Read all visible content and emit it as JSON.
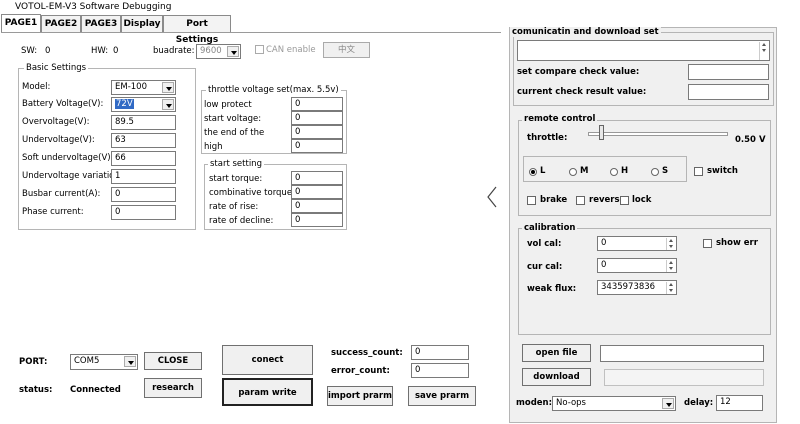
{
  "window": {
    "title": "VOTOL-EM-V3 Software Debugging"
  },
  "tabs": [
    {
      "label": "PAGE1"
    },
    {
      "label": "PAGE2"
    },
    {
      "label": "PAGE3"
    },
    {
      "label": "Display"
    },
    {
      "label": "Port Settings"
    }
  ],
  "top": {
    "sw_label": "SW:",
    "sw_value": "0",
    "hw_label": "HW:",
    "hw_value": "0",
    "baud_label": "buadrate:",
    "baud_value": "9600",
    "can_label": "CAN enable",
    "lang_button": "中文"
  },
  "basic": {
    "title": "Basic Settings",
    "model_label": "Model:",
    "model_value": "EM-100",
    "battery_label": "Battery Voltage(V):",
    "battery_value": "72V",
    "overvoltage_label": "Overvoltage(V):",
    "overvoltage_value": "89.5",
    "undervoltage_label": "Undervoltage(V):",
    "undervoltage_value": "63",
    "soft_under_label": "Soft undervoltage(V):",
    "soft_under_value": "66",
    "under_var_label": "Undervoltage variation:",
    "under_var_value": "1",
    "busbar_label": "Busbar current(A):",
    "busbar_value": "0",
    "phase_label": "Phase current:",
    "phase_value": "0"
  },
  "throttle_voltage": {
    "title": "throttle voltage set(max. 5.5v)",
    "rows": [
      {
        "label": "low protect",
        "value": "0"
      },
      {
        "label": "start voltage:",
        "value": "0"
      },
      {
        "label": "the end of the",
        "value": "0"
      },
      {
        "label": "high",
        "value": "0"
      }
    ]
  },
  "start_setting": {
    "title": "start setting",
    "rows": [
      {
        "label": "start torque:",
        "value": "0"
      },
      {
        "label": "combinative torque:",
        "value": "0"
      },
      {
        "label": "rate of rise:",
        "value": "0"
      },
      {
        "label": "rate of decline:",
        "value": "0"
      }
    ]
  },
  "bottom": {
    "port_label": "PORT:",
    "port_value": "COM5",
    "close_button": "CLOSE",
    "status_label": "status:",
    "status_value": "Connected",
    "research_button": "research",
    "connect_button": "conect",
    "param_write_button": "param write",
    "success_label": "success_count:",
    "success_value": "0",
    "error_label": "error_count:",
    "error_value": "0",
    "import_button": "import prarm",
    "save_button": "save prarm"
  },
  "right": {
    "comm_title": "comunicatin and download set",
    "compare_label": "set compare check value:",
    "current_label": "current check result value:",
    "remote_title": "remote control",
    "throttle_label": "throttle:",
    "throttle_value": "0.50",
    "throttle_unit": "V",
    "throttle_level": 0.09,
    "radios": [
      {
        "label": "L",
        "selected": true
      },
      {
        "label": "M",
        "selected": false
      },
      {
        "label": "H",
        "selected": false
      },
      {
        "label": "S",
        "selected": false
      }
    ],
    "switch_label": "switch",
    "brake_label": "brake",
    "reverse_label": "reverse",
    "lock_label": "lock",
    "calib_title": "calibration",
    "vol_cal_label": "vol cal:",
    "vol_cal_value": "0",
    "cur_cal_label": "cur cal:",
    "cur_cal_value": "0",
    "weak_flux_label": "weak flux:",
    "weak_flux_value": "3435973836",
    "show_err_label": "show err",
    "open_file_button": "open file",
    "download_button": "download",
    "moden_label": "moden:",
    "moden_value": "No-ops",
    "delay_label": "delay:",
    "delay_value": "12"
  },
  "icons": {
    "collapse": "chevron-left-icon",
    "app": "app-icon"
  }
}
